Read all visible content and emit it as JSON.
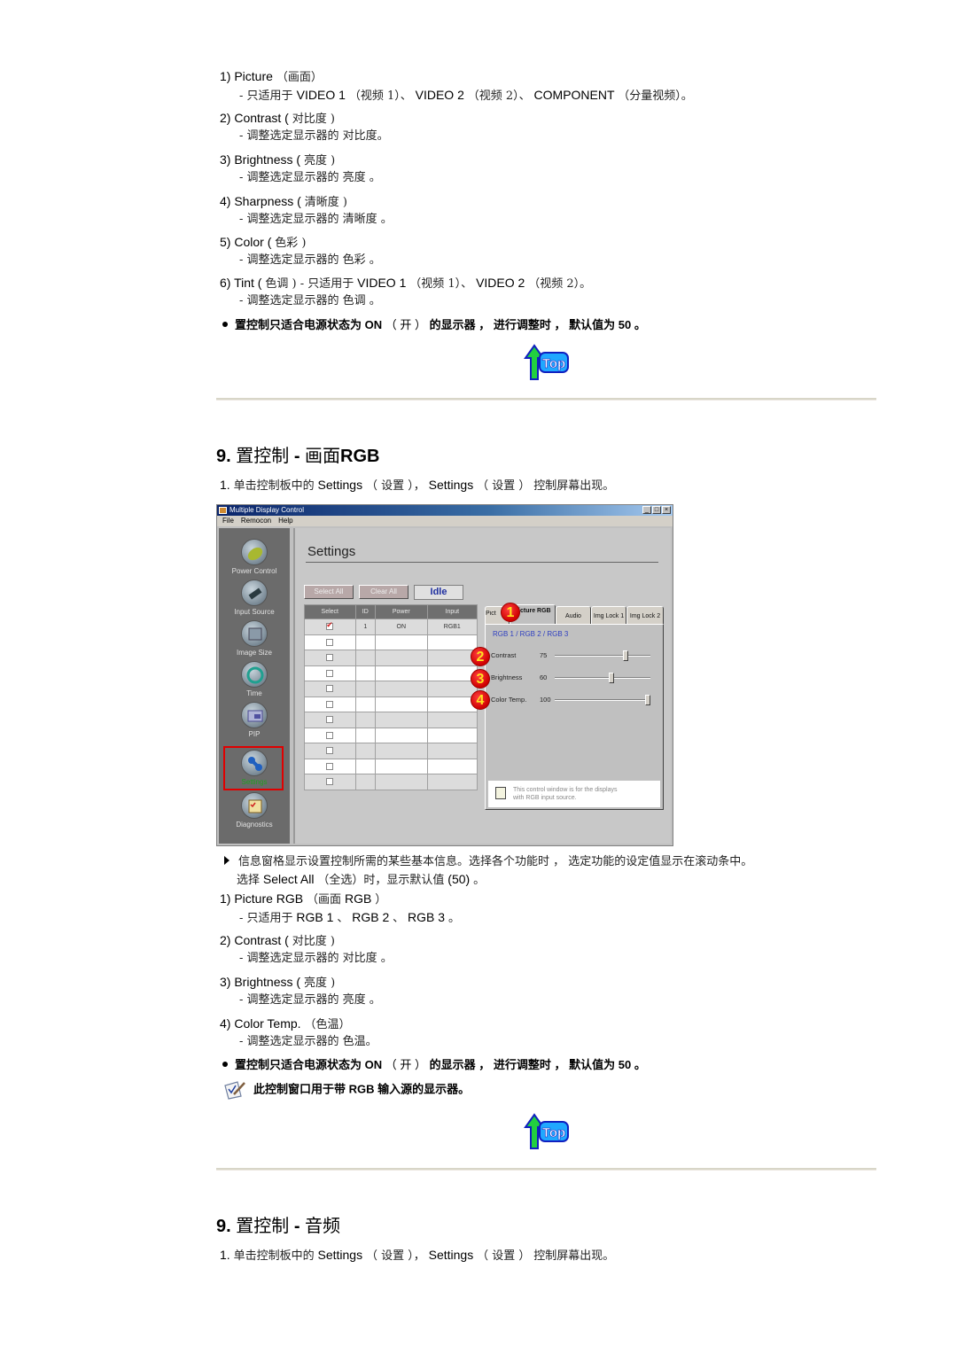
{
  "section_picture": {
    "items": [
      {
        "num": "1)",
        "title": "Picture",
        "title_cn": "（画面）",
        "desc": "- 只适用于 ",
        "desc_parts": [
          "VIDEO 1",
          "（视频 1）、",
          "VIDEO 2",
          "（视频 2）、",
          "COMPONENT",
          "（分量视频）。"
        ]
      },
      {
        "num": "2)",
        "title": "Contrast (",
        "title_cn": "对比度 )",
        "desc": "- 调整选定显示器的 对比度。"
      },
      {
        "num": "3)",
        "title": "Brightness (",
        "title_cn": "亮度 )",
        "desc": "- 调整选定显示器的 亮度 。"
      },
      {
        "num": "4)",
        "title": "Sharpness (",
        "title_cn": "清晰度 )",
        "desc": "- 调整选定显示器的 清晰度 。"
      },
      {
        "num": "5)",
        "title": "Color (",
        "title_cn": "色彩 )",
        "desc": "- 调整选定显示器的 色彩 。"
      },
      {
        "num": "6)",
        "title": "Tint (",
        "title_cn": "色调 ) - 只适用于",
        "extra": [
          "VIDEO 1",
          "（视频 1）、",
          "VIDEO 2",
          "（视频 2）。"
        ],
        "desc": "- 调整选定显示器的 色调 。"
      }
    ],
    "note_parts": [
      "置控制只适合电源状态为",
      "ON",
      "（ 开 ）",
      "的显示器 ，",
      "进行调整时 ，",
      "默认值为",
      "50",
      "。"
    ]
  },
  "top_button": {
    "label": "Top"
  },
  "section_rgb": {
    "heading_num": "9.",
    "heading_cn": "置控制",
    "heading_dash": "-",
    "heading_tail_cn": "画面",
    "heading_tail_en": "RGB",
    "step1_parts": [
      "1.",
      "单击控制板中的",
      "Settings",
      "（ 设置 ），",
      "Settings",
      "（ 设置 ）",
      "控制屏幕出现。"
    ],
    "info_line1": "信息窗格显示设置控制所需的某些基本信息。选择各个功能时 ，  选定功能的设定值显示在滚动条中。",
    "info_line2_parts": [
      "选择",
      "Select All",
      "（全选）时，显示默认值",
      "(50)",
      "。"
    ],
    "items": [
      {
        "num": "1)",
        "title": "Picture RGB",
        "title_cn": "（画面",
        "title_en2": "RGB",
        "title_end": "）",
        "desc_parts": [
          "- 只适用于",
          "RGB 1",
          "、",
          "RGB 2",
          "、",
          "RGB 3",
          "。"
        ]
      },
      {
        "num": "2)",
        "title": "Contrast (",
        "title_cn": "对比度 )",
        "desc": "- 调整选定显示器的 对比度 。"
      },
      {
        "num": "3)",
        "title": "Brightness (",
        "title_cn": "亮度 )",
        "desc": "- 调整选定显示器的 亮度 。"
      },
      {
        "num": "4)",
        "title": "Color Temp.",
        "title_cn": "（色温）",
        "desc": "- 调整选定显示器的 色温。"
      }
    ],
    "note_parts": [
      "置控制只适合电源状态为",
      "ON",
      "（ 开 ）",
      "的显示器 ，",
      "进行调整时 ，",
      "默认值为",
      "50",
      "。"
    ],
    "rgb_note_parts": [
      "此控制窗口用于带",
      "RGB",
      "输入源的显示器。"
    ]
  },
  "section_audio": {
    "heading_num": "9.",
    "heading_cn": "置控制",
    "heading_dash": "-",
    "heading_tail_cn": "音频",
    "step1_parts": [
      "1.",
      "单击控制板中的",
      "Settings",
      "（ 设置 ），",
      "Settings",
      "（ 设置 ）",
      "控制屏幕出现。"
    ]
  },
  "app": {
    "title": "Multiple Display Control",
    "window_buttons": [
      "_",
      "□",
      "×"
    ],
    "menu": [
      "File",
      "Remocon",
      "Help"
    ],
    "sidebar": [
      {
        "label": "Power Control",
        "icon": "power-plug-icon"
      },
      {
        "label": "Input Source",
        "icon": "input-cable-icon"
      },
      {
        "label": "Image Size",
        "icon": "image-size-icon"
      },
      {
        "label": "Time",
        "icon": "clock-icon"
      },
      {
        "label": "PIP",
        "icon": "pip-icon"
      },
      {
        "label": "Settings",
        "icon": "wrench-icon",
        "selected": true
      },
      {
        "label": "Diagnostics",
        "icon": "checklist-icon"
      }
    ],
    "settings_title": "Settings",
    "select_all": "Select All",
    "clear_all": "Clear All",
    "status": "Idle",
    "grid_headers": [
      "Select",
      "ID",
      "Power",
      "Input"
    ],
    "grid_rows": [
      {
        "checked": true,
        "id": "1",
        "power": "ON",
        "input": "RGB1"
      },
      {
        "checked": false,
        "id": "",
        "power": "",
        "input": ""
      },
      {
        "checked": false,
        "id": "",
        "power": "",
        "input": ""
      },
      {
        "checked": false,
        "id": "",
        "power": "",
        "input": ""
      },
      {
        "checked": false,
        "id": "",
        "power": "",
        "input": ""
      },
      {
        "checked": false,
        "id": "",
        "power": "",
        "input": ""
      },
      {
        "checked": false,
        "id": "",
        "power": "",
        "input": ""
      },
      {
        "checked": false,
        "id": "",
        "power": "",
        "input": ""
      },
      {
        "checked": false,
        "id": "",
        "power": "",
        "input": ""
      },
      {
        "checked": false,
        "id": "",
        "power": "",
        "input": ""
      },
      {
        "checked": false,
        "id": "",
        "power": "",
        "input": ""
      }
    ],
    "tabs": [
      "Picture",
      "Picture RGB",
      "Audio",
      "Img Lock 1",
      "Img Lock 2"
    ],
    "active_tab": "Picture RGB",
    "rgb_selector": "RGB 1 / RGB 2 / RGB 3",
    "sliders": [
      {
        "label": "Contrast",
        "value": 75,
        "max": 100
      },
      {
        "label": "Brightness",
        "value": 60,
        "max": 100
      },
      {
        "label": "Color Temp.",
        "value": 100,
        "max": 100
      }
    ],
    "info_note_line1": "This control window is for the displays",
    "info_note_line2": "with RGB input source.",
    "callouts": [
      "1",
      "2",
      "3",
      "4"
    ]
  }
}
